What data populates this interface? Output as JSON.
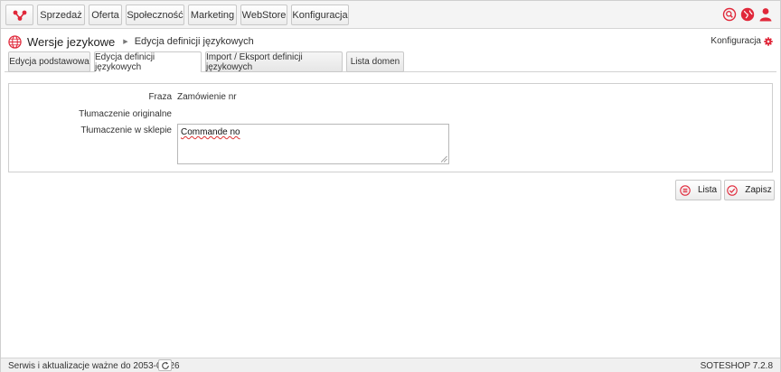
{
  "brand": {
    "accent": "#e0283a",
    "logo_icon": "soteshop-logo-icon"
  },
  "topnav": {
    "items": [
      "Sprzedaż",
      "Oferta",
      "Społeczność",
      "Marketing",
      "WebStore",
      "Konfiguracja"
    ],
    "right_icons": [
      "search-icon",
      "globe-icon",
      "user-icon"
    ]
  },
  "breadcrumb": {
    "icon": "globe-icon",
    "title": "Wersje jezykowe",
    "current": "Edycja definicji językowych"
  },
  "config_link": {
    "label": "Konfiguracja",
    "icon": "gear-icon"
  },
  "tabs": [
    {
      "label": "Edycja podstawowa",
      "active": false
    },
    {
      "label": "Edycja definicji językowych",
      "active": true
    },
    {
      "label": "Import / Eksport definicji językowych",
      "active": false
    },
    {
      "label": "Lista domen",
      "active": false
    }
  ],
  "form": {
    "phrase_label": "Fraza",
    "phrase_value": "Zamówienie nr",
    "original_label": "Tłumaczenie originalne",
    "original_value": "",
    "shop_label": "Tłumaczenie w sklepie",
    "shop_value": "Commande no"
  },
  "actions": {
    "list_label": "Lista",
    "list_icon": "list-icon",
    "save_label": "Zapisz",
    "save_icon": "checkmark-icon"
  },
  "footer": {
    "service_text": "Serwis i aktualizacje ważne do 2053-08-26",
    "refresh_icon": "refresh-icon",
    "version": "SOTESHOP 7.2.8"
  }
}
